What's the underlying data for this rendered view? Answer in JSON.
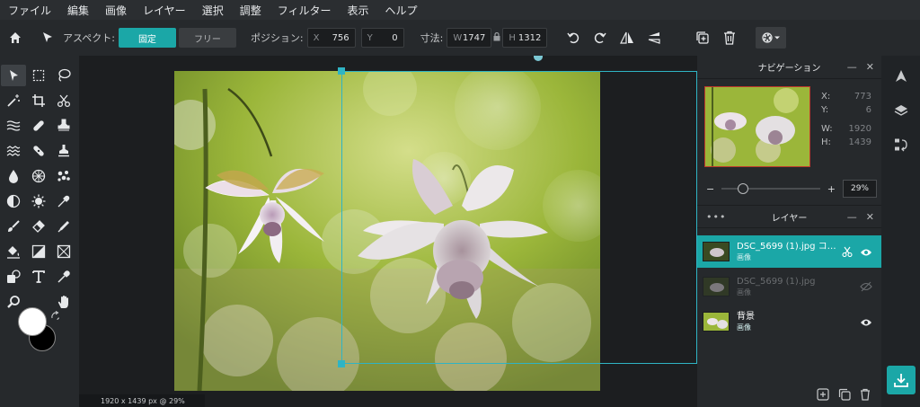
{
  "menubar": {
    "items": [
      "ファイル",
      "編集",
      "画像",
      "レイヤー",
      "選択",
      "調整",
      "フィルター",
      "表示",
      "ヘルプ"
    ]
  },
  "toolbar": {
    "aspect_label": "アスペクト:",
    "fixed_label": "固定",
    "free_label": "フリー",
    "position_label": "ポジション:",
    "x_key": "X",
    "x_value": "756",
    "y_key": "Y",
    "y_value": "0",
    "size_label": "寸法:",
    "w_key": "W",
    "w_value": "1747",
    "h_key": "H",
    "h_value": "1312"
  },
  "navigator": {
    "title": "ナビゲーション",
    "x_key": "X:",
    "x_value": "773",
    "y_key": "Y:",
    "y_value": "6",
    "w_key": "W:",
    "w_value": "1920",
    "h_key": "H:",
    "h_value": "1439",
    "zoom_value": "29%",
    "zoom_fraction": 0.29
  },
  "layers": {
    "title": "レイヤー",
    "items": [
      {
        "name": "DSC_5699 (1).jpg コ…",
        "sub": "画像",
        "selected": true
      },
      {
        "name": "DSC_5699 (1).jpg",
        "sub": "画像",
        "hidden": true
      },
      {
        "name": "背景",
        "sub": "画像"
      }
    ]
  },
  "status": {
    "text": "1920 x 1439 px @ 29%"
  },
  "colors": {
    "accent": "#1ba7a7",
    "foreground": "#ffffff",
    "background": "#000000"
  }
}
